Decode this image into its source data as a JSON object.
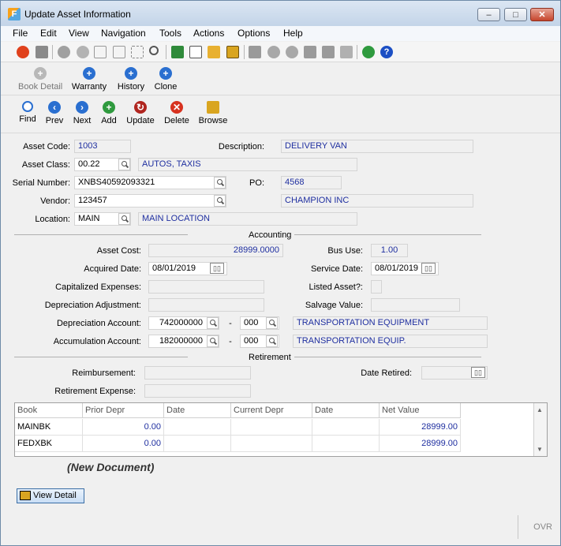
{
  "window": {
    "title": "Update Asset Information",
    "controls": [
      "‒",
      "□",
      "✕"
    ]
  },
  "menu": [
    "File",
    "Edit",
    "View",
    "Navigation",
    "Tools",
    "Actions",
    "Options",
    "Help"
  ],
  "detail_buttons": [
    "Book Detail",
    "Warranty",
    "History",
    "Clone"
  ],
  "nav_buttons": [
    "Find",
    "Prev",
    "Next",
    "Add",
    "Update",
    "Delete",
    "Browse"
  ],
  "colors": {
    "accent": "#1f2fa0",
    "title_bg": "#c3d4e8",
    "link_blue": "#2a6fd0"
  },
  "form": {
    "asset_code_label": "Asset Code:",
    "asset_code": "1003",
    "description_label": "Description:",
    "description": "DELIVERY VAN",
    "asset_class_label": "Asset Class:",
    "asset_class": "00.22",
    "asset_class_desc": "AUTOS, TAXIS",
    "serial_label": "Serial Number:",
    "serial": "XNBS40592093321",
    "po_label": "PO:",
    "po": "4568",
    "vendor_label": "Vendor:",
    "vendor": "123457",
    "vendor_name": "CHAMPION INC",
    "location_label": "Location:",
    "location": "MAIN",
    "location_desc": "MAIN LOCATION"
  },
  "accounting": {
    "heading": "Accounting",
    "asset_cost_label": "Asset Cost:",
    "asset_cost": "28999.0000",
    "bus_use_label": "Bus Use:",
    "bus_use": "1.00",
    "acquired_label": "Acquired Date:",
    "acquired": "08/01/2019",
    "service_label": "Service Date:",
    "service": "08/01/2019",
    "cap_exp_label": "Capitalized Expenses:",
    "listed_label": "Listed Asset?:",
    "dep_adj_label": "Depreciation Adjustment:",
    "salvage_label": "Salvage Value:",
    "dep_acct_label": "Depreciation Account:",
    "dep_acct": "742000000",
    "dep_sub": "000",
    "dep_desc": "TRANSPORTATION EQUIPMENT",
    "acc_acct_label": "Accumulation Account:",
    "acc_acct": "182000000",
    "acc_sub": "000",
    "acc_desc": "TRANSPORTATION EQUIP.",
    "dash": "-"
  },
  "retirement": {
    "heading": "Retirement",
    "reimb_label": "Reimbursement:",
    "date_retired_label": "Date Retired:",
    "ret_exp_label": "Retirement Expense:"
  },
  "grid": {
    "columns": [
      "Book",
      "Prior Depr",
      "Date",
      "Current Depr",
      "Date",
      "Net Value"
    ],
    "rows": [
      [
        "MAINBK",
        "0.00",
        "",
        "",
        "",
        "28999.00"
      ],
      [
        "FEDXBK",
        "0.00",
        "",
        "",
        "",
        "28999.00"
      ]
    ]
  },
  "status": {
    "new_document": "(New Document)",
    "view_detail": "View Detail",
    "ovr": "OVR",
    "cal_glyph": "▯▯"
  }
}
